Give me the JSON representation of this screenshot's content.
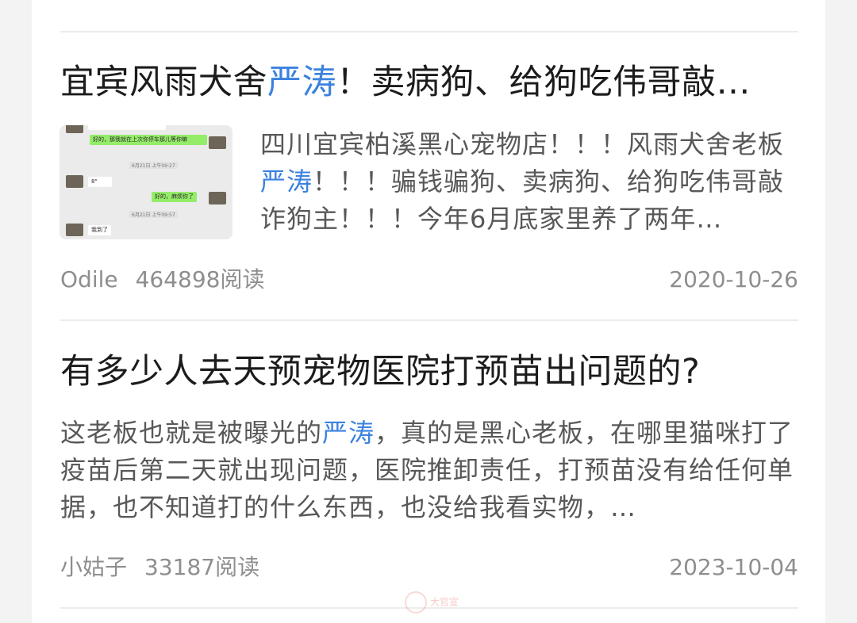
{
  "articles": [
    {
      "title_prefix": "宜宾风雨犬舍",
      "title_highlight": "严涛",
      "title_suffix": "！卖病狗、给狗吃伟哥敲…",
      "summary_prefix": "四川宜宾柏溪黑心宠物店！！！风雨犬舍老板",
      "summary_highlight": "严涛",
      "summary_suffix": "！！！骗钱骗狗、卖病狗、给狗吃伟哥敲诈狗主！！！今年6月底家里养了两年…",
      "author": "Odile",
      "views": "464898阅读",
      "date": "2020-10-26",
      "thumbnail": {
        "msg_top": "好的，那我就在上次你停车那儿等你嘛",
        "time_1": "6月21日 上午09:27",
        "voice": "8\"",
        "msg_reply": "好的，麻烦你了",
        "time_2": "6月21日 上午09:57",
        "msg_bottom": "我到了"
      }
    },
    {
      "title": "有多少人去天预宠物医院打预苗出问题的?",
      "summary_prefix": "这老板也就是被曝光的",
      "summary_highlight": "严涛",
      "summary_suffix": "，真的是黑心老板，在哪里猫咪打了疫苗后第二天就出现问题，医院推卸责任，打预苗没有给任何单据，也不知道打的什么东西，也没给我看实物，…",
      "author": "小姑子",
      "views": "33187阅读",
      "date": "2023-10-04"
    }
  ],
  "watermark": "大官宣",
  "colors": {
    "highlight": "#3b82e0",
    "title": "#1c1c1c",
    "summary": "#585858",
    "meta": "#8e8e8e"
  }
}
